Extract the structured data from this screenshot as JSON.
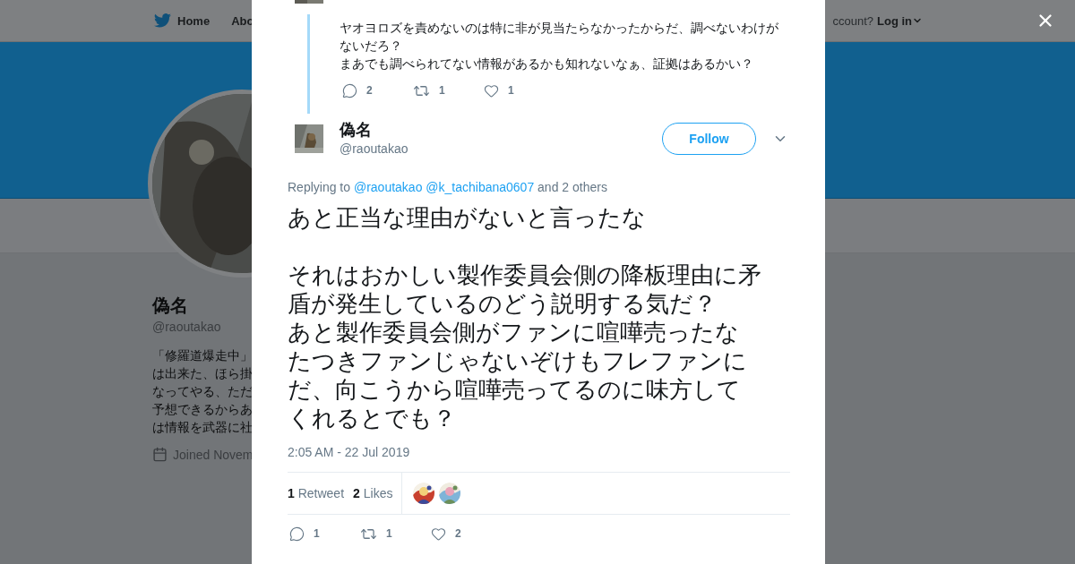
{
  "nav": {
    "items": [
      {
        "label": "Home"
      },
      {
        "label": "Abo"
      }
    ],
    "account_prompt": "ccount?",
    "login": "Log in"
  },
  "profile": {
    "name": "偽名",
    "handle": "@raoutakao",
    "bio_lines": [
      "「修羅道爆走中」",
      "は出来た、ほら掛",
      "なってやる、ただ",
      "予想できるからあ",
      "は情報を武器に社"
    ],
    "joined": "Joined Novem"
  },
  "modal": {
    "parent_tweet": {
      "paragraphs": [
        "ヤオヨロズを責めないのは特に非が見当たらなかったからだ、調べないわけがないだろ？",
        "まあでも調べられてない情報があるかも知れないなぁ、証拠はあるかい？"
      ],
      "actions": [
        {
          "kind": "reply",
          "count": "2"
        },
        {
          "kind": "retweet",
          "count": "1"
        },
        {
          "kind": "like",
          "count": "1"
        }
      ]
    },
    "tweet": {
      "author": {
        "name": "偽名",
        "handle": "@raoutakao"
      },
      "follow_label": "Follow",
      "replying": {
        "prefix": "Replying to",
        "mentions": [
          "@raoutakao",
          "@k_tachibana0607"
        ],
        "others": "and 2 others"
      },
      "paragraphs": [
        "あと正当な理由がないと言ったな",
        "それはおかしい製作委員会側の降板理由に矛盾が発生しているのどう説明する気だ？",
        "あと製作委員会側がファンに喧嘩売ったなたつきファンじゃないぞけもフレファンに",
        "だ、向こうから喧嘩売ってるのに味方してくれるとでも？"
      ],
      "timestamp": "2:05 AM - 22 Jul 2019",
      "stats": [
        {
          "count": "1",
          "label": "Retweet"
        },
        {
          "count": "2",
          "label": "Likes"
        }
      ],
      "likers": [
        {
          "kind": "picture"
        },
        {
          "kind": "picture"
        }
      ],
      "actions": [
        {
          "kind": "reply",
          "count": "1"
        },
        {
          "kind": "retweet",
          "count": "1"
        },
        {
          "kind": "like",
          "count": "2"
        }
      ]
    }
  }
}
